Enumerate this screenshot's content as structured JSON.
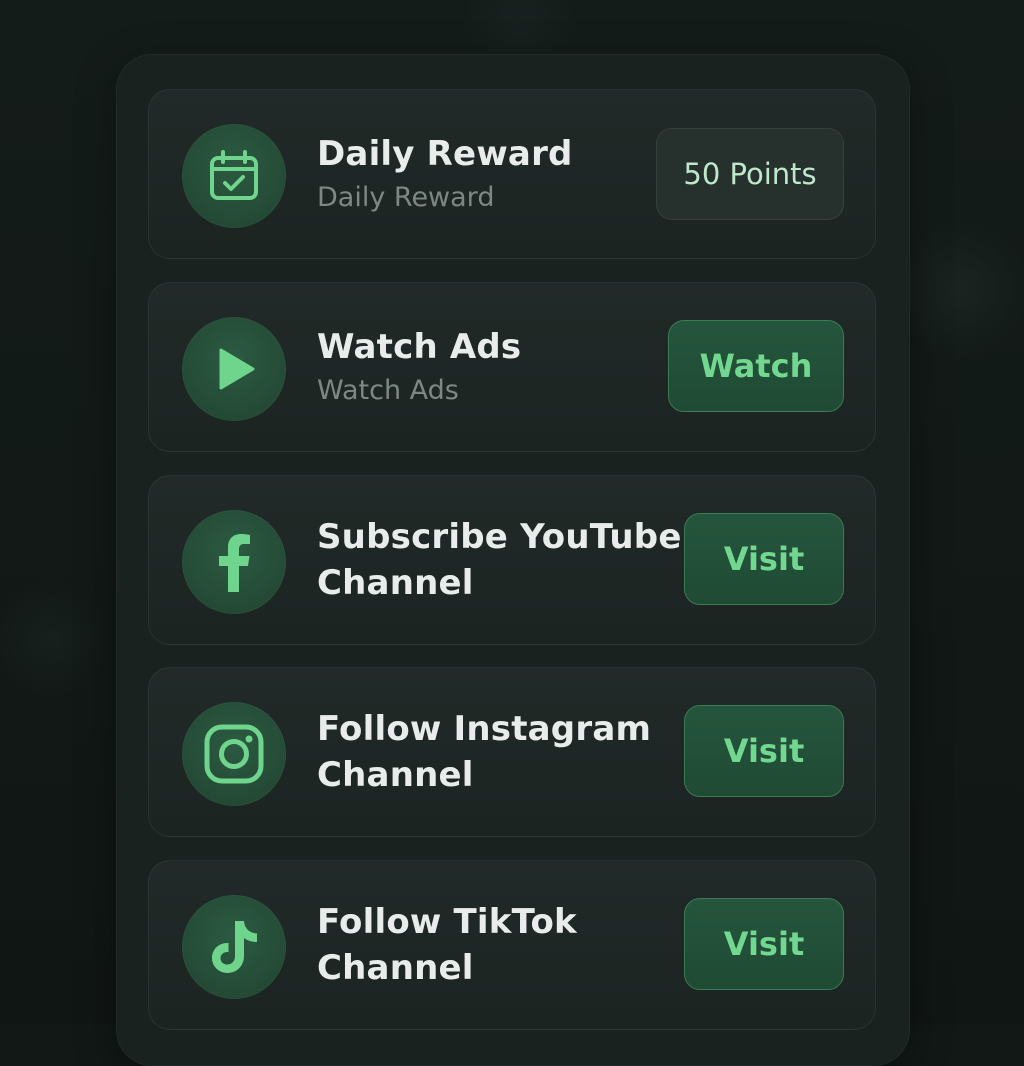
{
  "tasks": [
    {
      "title": "Daily Reward",
      "subtitle": "Daily Reward",
      "icon": "calendar-check-icon",
      "action_label": "50 Points"
    },
    {
      "title": "Watch Ads",
      "subtitle": "Watch Ads",
      "icon": "play-icon",
      "action_label": "Watch"
    },
    {
      "title_line1": "Subscribe YouTube",
      "title_line2": "Channel",
      "icon": "facebook-icon",
      "action_label": "Visit"
    },
    {
      "title_line1": "Follow Instagram",
      "title_line2": "Channel",
      "icon": "instagram-icon",
      "action_label": "Visit"
    },
    {
      "title_line1": "Follow TikTok",
      "title_line2": "Channel",
      "icon": "tiktok-icon",
      "action_label": "Visit"
    }
  ],
  "colors": {
    "accent": "#6fd48c",
    "background": "#111816",
    "card": "#1f2826"
  }
}
